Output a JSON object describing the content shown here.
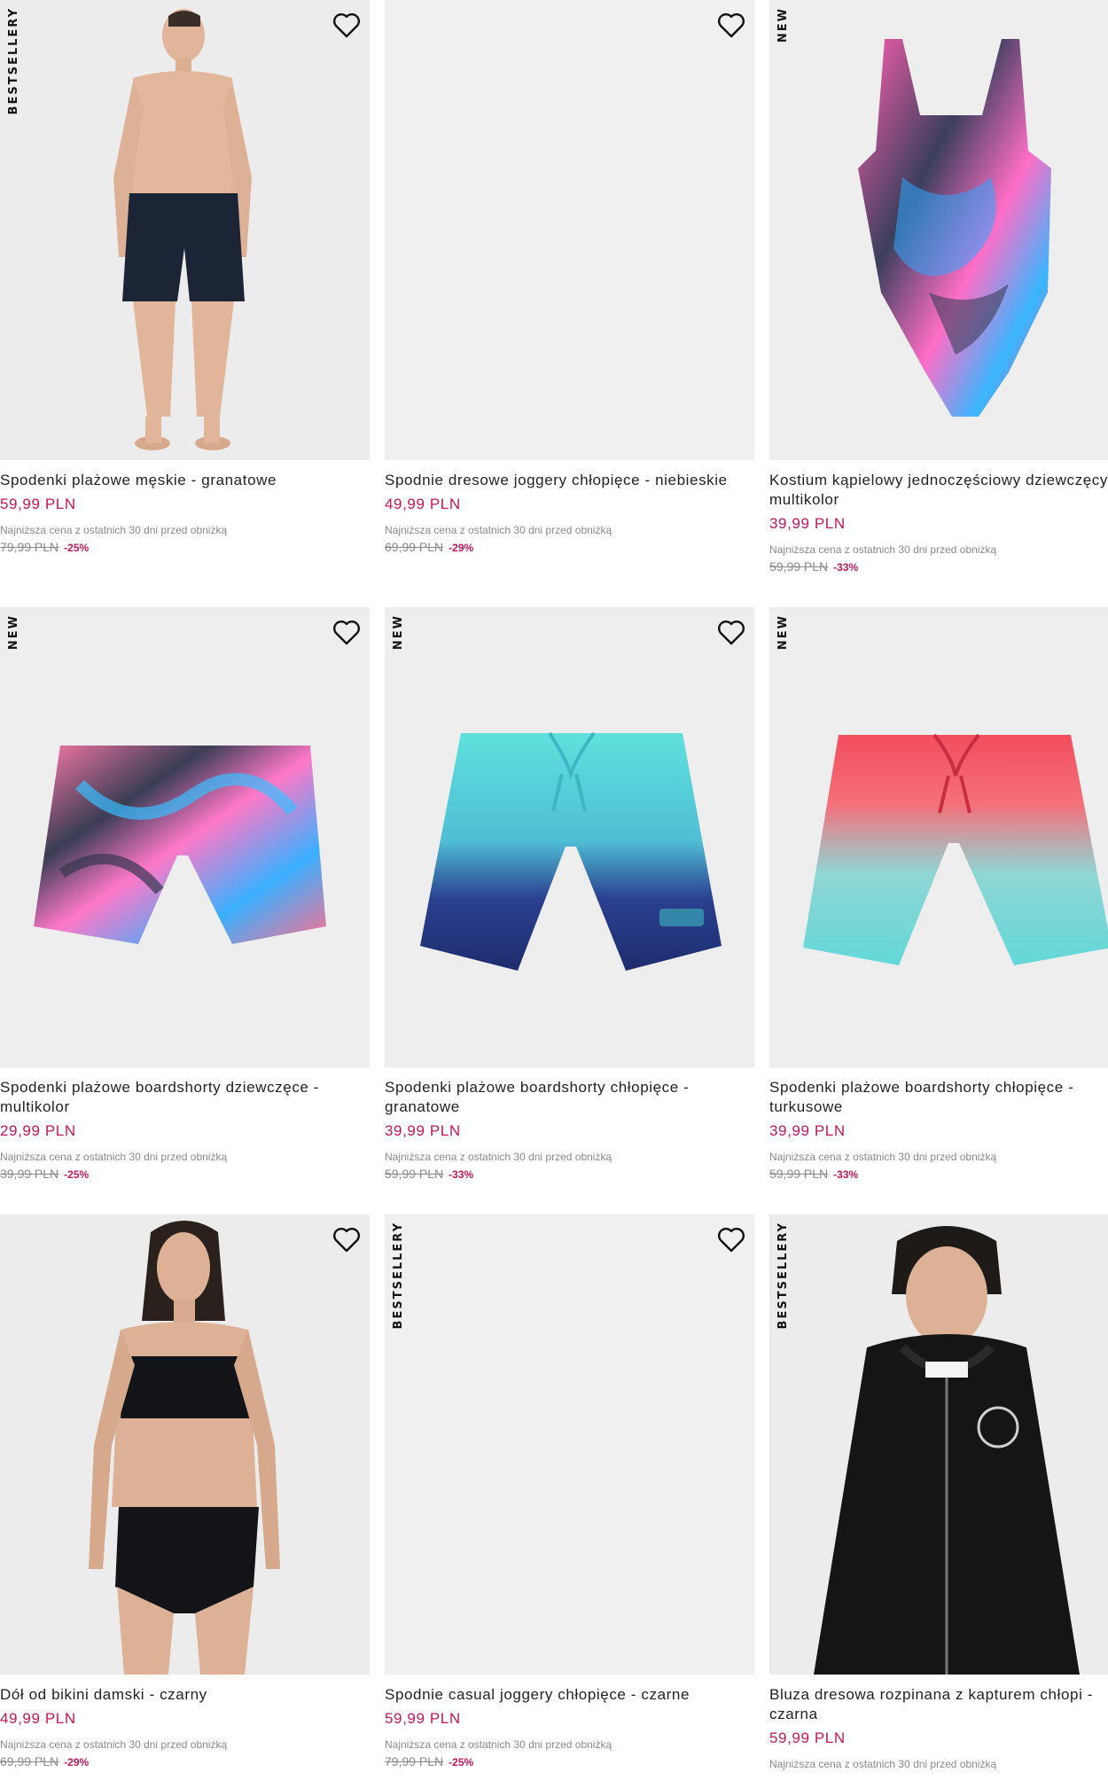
{
  "icons": {
    "favorite": "heart-outline-icon"
  },
  "colors": {
    "price": "#c4165a",
    "discount": "#c4165a",
    "old_price": "#8a8a8a",
    "image_bg": "#eeeeee"
  },
  "products": [
    {
      "badge": "BESTSELLERY",
      "name": "Spodenki plażowe męskie - granatowe",
      "price": "59,99 PLN",
      "lowest_label": "Najniższa cena z ostatnich 30 dni przed obniżką",
      "old_price": "79,99 PLN",
      "discount": "-25%"
    },
    {
      "badge": "",
      "name": "Spodnie dresowe joggery chłopięce - niebieskie",
      "price": "49,99 PLN",
      "lowest_label": "Najniższa cena z ostatnich 30 dni przed obniżką",
      "old_price": "69,99 PLN",
      "discount": "-29%"
    },
    {
      "badge": "NEW",
      "name": "Kostium kąpielowy jednoczęściowy dziewczęcy - multikolor",
      "price": "39,99 PLN",
      "lowest_label": "Najniższa cena z ostatnich 30 dni przed obniżką",
      "old_price": "59,99 PLN",
      "discount": "-33%"
    },
    {
      "badge": "NEW",
      "name": "Spodenki plażowe boardshorty dziewczęce - multikolor",
      "price": "29,99 PLN",
      "lowest_label": "Najniższa cena z ostatnich 30 dni przed obniżką",
      "old_price": "39,99 PLN",
      "discount": "-25%"
    },
    {
      "badge": "NEW",
      "name": "Spodenki plażowe boardshorty chłopięce - granatowe",
      "price": "39,99 PLN",
      "lowest_label": "Najniższa cena z ostatnich 30 dni przed obniżką",
      "old_price": "59,99 PLN",
      "discount": "-33%"
    },
    {
      "badge": "NEW",
      "name": "Spodenki plażowe boardshorty chłopięce - turkusowe",
      "price": "39,99 PLN",
      "lowest_label": "Najniższa cena z ostatnich 30 dni przed obniżką",
      "old_price": "59,99 PLN",
      "discount": "-33%"
    },
    {
      "badge": "",
      "name": "Dół od bikini damski - czarny",
      "price": "49,99 PLN",
      "lowest_label": "Najniższa cena z ostatnich 30 dni przed obniżką",
      "old_price": "69,99 PLN",
      "discount": "-29%"
    },
    {
      "badge": "BESTSELLERY",
      "name": "Spodnie casual joggery chłopięce - czarne",
      "price": "59,99 PLN",
      "lowest_label": "Najniższa cena z ostatnich 30 dni przed obniżką",
      "old_price": "79,99 PLN",
      "discount": "-25%"
    },
    {
      "badge": "BESTSELLERY",
      "name": "Bluza dresowa rozpinana z kapturem chłopi - czarna",
      "price": "59,99 PLN",
      "lowest_label": "Najniższa cena z ostatnich 30 dni przed obniżką",
      "old_price": "",
      "discount": ""
    }
  ]
}
